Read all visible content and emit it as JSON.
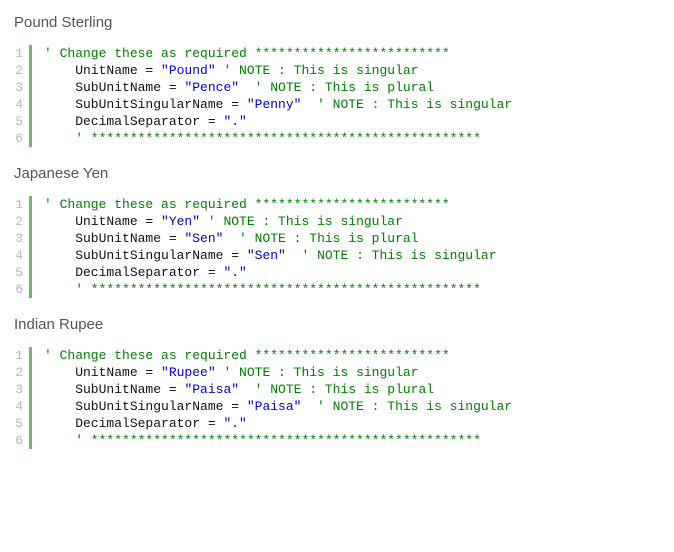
{
  "blocks": [
    {
      "heading": "Pound Sterling",
      "lines": [
        [
          {
            "cls": "cm",
            "t": "' Change these as required *************************"
          }
        ],
        [
          {
            "cls": "id",
            "t": "    UnitName "
          },
          {
            "cls": "op",
            "t": "= "
          },
          {
            "cls": "st",
            "t": "\"Pound\""
          },
          {
            "cls": "cm",
            "t": " ' NOTE : This is singular"
          }
        ],
        [
          {
            "cls": "id",
            "t": "    SubUnitName "
          },
          {
            "cls": "op",
            "t": "= "
          },
          {
            "cls": "st",
            "t": "\"Pence\""
          },
          {
            "cls": "cm",
            "t": "  ' NOTE : This is plural"
          }
        ],
        [
          {
            "cls": "id",
            "t": "    SubUnitSingularName "
          },
          {
            "cls": "op",
            "t": "= "
          },
          {
            "cls": "st",
            "t": "\"Penny\""
          },
          {
            "cls": "cm",
            "t": "  ' NOTE : This is singular"
          }
        ],
        [
          {
            "cls": "id",
            "t": "    DecimalSeparator "
          },
          {
            "cls": "op",
            "t": "= "
          },
          {
            "cls": "st",
            "t": "\".\""
          }
        ],
        [
          {
            "cls": "cm",
            "t": "    ' **************************************************"
          }
        ]
      ]
    },
    {
      "heading": "Japanese Yen",
      "lines": [
        [
          {
            "cls": "cm",
            "t": "' Change these as required *************************"
          }
        ],
        [
          {
            "cls": "id",
            "t": "    UnitName "
          },
          {
            "cls": "op",
            "t": "= "
          },
          {
            "cls": "st",
            "t": "\"Yen\""
          },
          {
            "cls": "cm",
            "t": " ' NOTE : This is singular"
          }
        ],
        [
          {
            "cls": "id",
            "t": "    SubUnitName "
          },
          {
            "cls": "op",
            "t": "= "
          },
          {
            "cls": "st",
            "t": "\"Sen\""
          },
          {
            "cls": "cm",
            "t": "  ' NOTE : This is plural"
          }
        ],
        [
          {
            "cls": "id",
            "t": "    SubUnitSingularName "
          },
          {
            "cls": "op",
            "t": "= "
          },
          {
            "cls": "st",
            "t": "\"Sen\""
          },
          {
            "cls": "cm",
            "t": "  ' NOTE : This is singular"
          }
        ],
        [
          {
            "cls": "id",
            "t": "    DecimalSeparator "
          },
          {
            "cls": "op",
            "t": "= "
          },
          {
            "cls": "st",
            "t": "\".\""
          }
        ],
        [
          {
            "cls": "cm",
            "t": "    ' **************************************************"
          }
        ]
      ]
    },
    {
      "heading": "Indian Rupee",
      "lines": [
        [
          {
            "cls": "cm",
            "t": "' Change these as required *************************"
          }
        ],
        [
          {
            "cls": "id",
            "t": "    UnitName "
          },
          {
            "cls": "op",
            "t": "= "
          },
          {
            "cls": "st",
            "t": "\"Rupee\""
          },
          {
            "cls": "cm",
            "t": " ' NOTE : This is singular"
          }
        ],
        [
          {
            "cls": "id",
            "t": "    SubUnitName "
          },
          {
            "cls": "op",
            "t": "= "
          },
          {
            "cls": "st",
            "t": "\"Paisa\""
          },
          {
            "cls": "cm",
            "t": "  ' NOTE : This is plural"
          }
        ],
        [
          {
            "cls": "id",
            "t": "    SubUnitSingularName "
          },
          {
            "cls": "op",
            "t": "= "
          },
          {
            "cls": "st",
            "t": "\"Paisa\""
          },
          {
            "cls": "cm",
            "t": "  ' NOTE : This is singular"
          }
        ],
        [
          {
            "cls": "id",
            "t": "    DecimalSeparator "
          },
          {
            "cls": "op",
            "t": "= "
          },
          {
            "cls": "st",
            "t": "\".\""
          }
        ],
        [
          {
            "cls": "cm",
            "t": "    ' **************************************************"
          }
        ]
      ]
    }
  ]
}
